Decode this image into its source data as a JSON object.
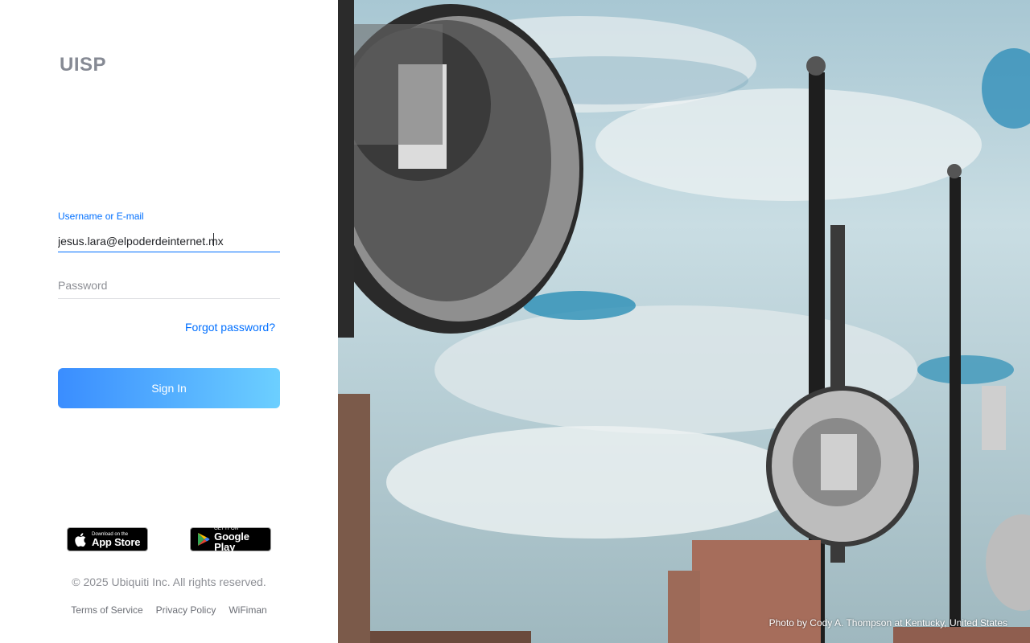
{
  "brand": {
    "logo_text": "UISP"
  },
  "login": {
    "username_label": "Username or E-mail",
    "username_value": "jesus.lara@elpoderdeinternet.mx",
    "password_placeholder": "Password",
    "forgot_password": "Forgot password?",
    "sign_in": "Sign In"
  },
  "apps": {
    "appstore_small": "Download on the",
    "appstore_big": "App Store",
    "gplay_small": "GET IT ON",
    "gplay_big": "Google Play"
  },
  "footer": {
    "copyright": "© 2025 Ubiquiti Inc. All rights reserved.",
    "links": [
      "Terms of Service",
      "Privacy Policy",
      "WiFiman"
    ]
  },
  "photo": {
    "credit": "Photo by Cody A. Thompson at Kentucky, United States"
  },
  "colors": {
    "accent": "#006fff",
    "button_gradient_start": "#3a8dff",
    "button_gradient_end": "#6ccfff"
  }
}
